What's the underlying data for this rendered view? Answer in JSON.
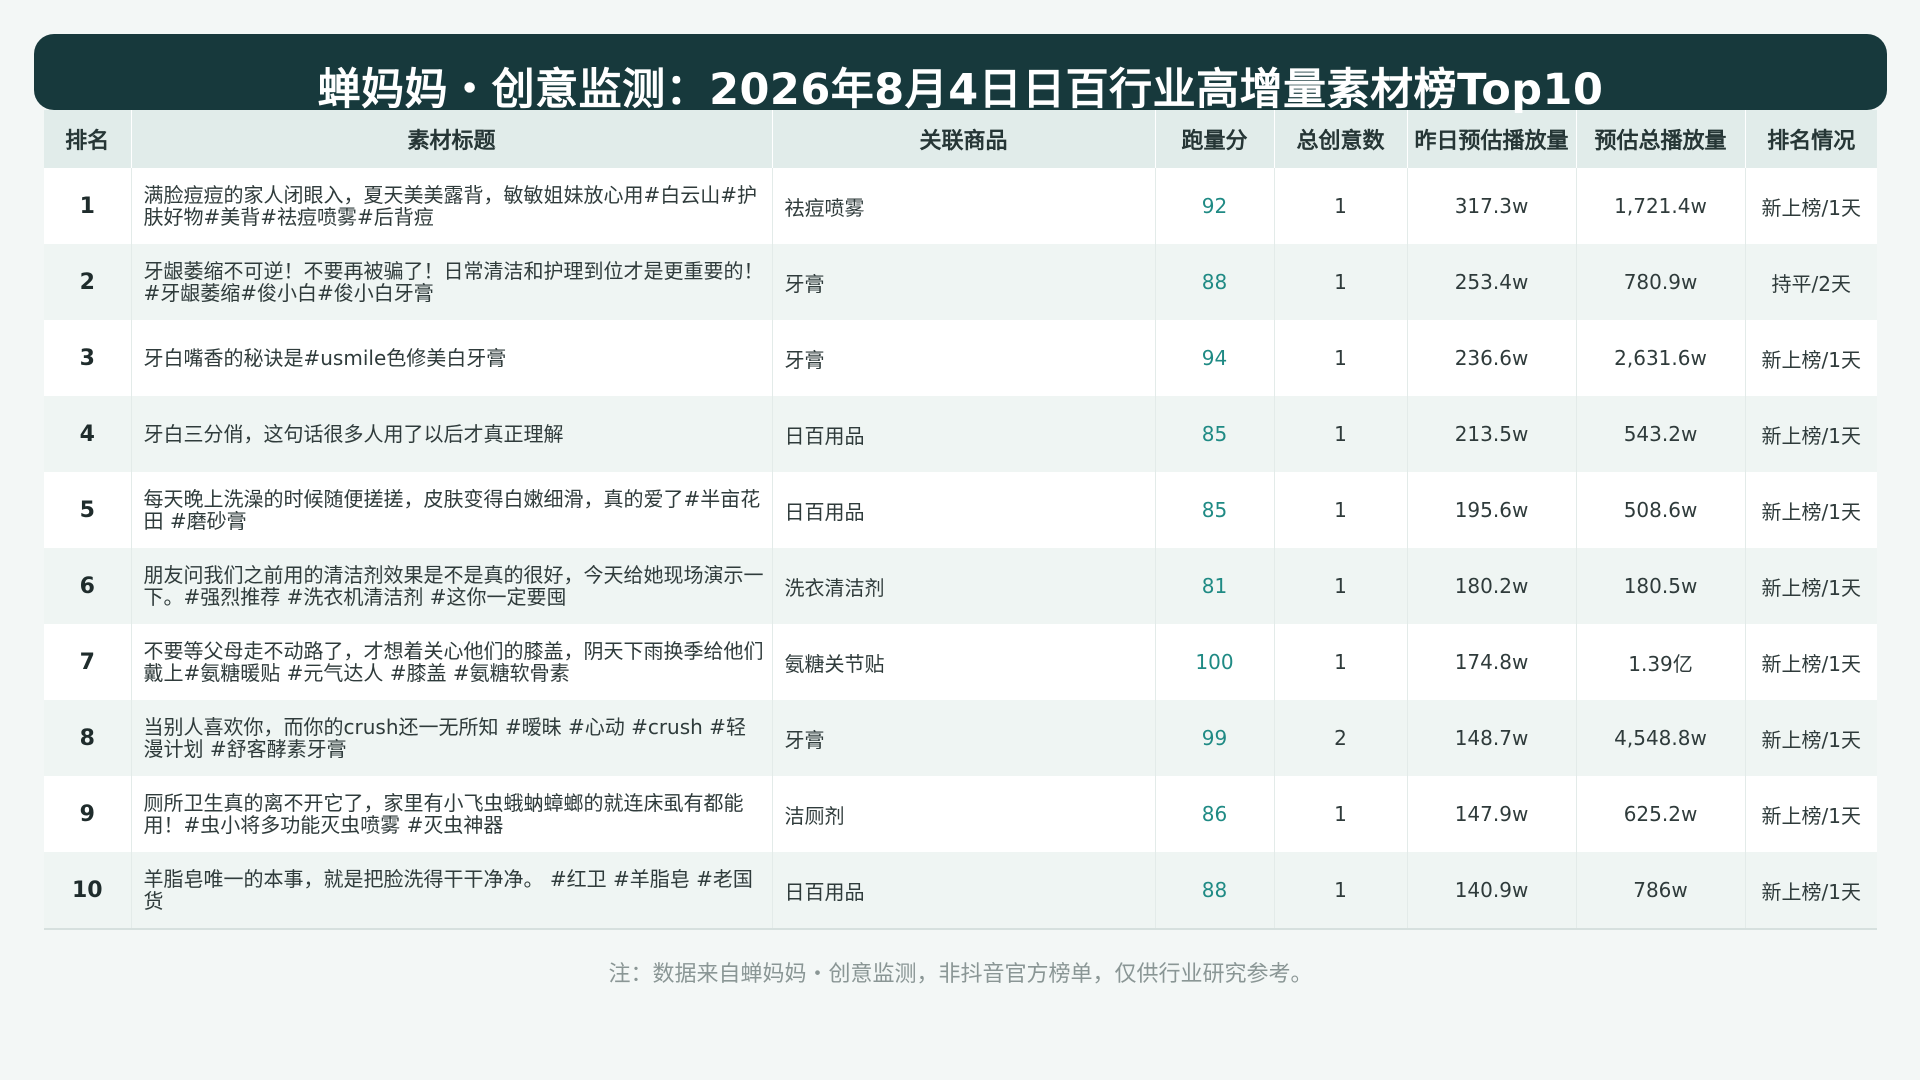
{
  "title": "蝉妈妈・创意监测：2026年8月4日日百行业高增量素材榜Top10",
  "columns": [
    "排名",
    "素材标题",
    "关联商品",
    "跑量分",
    "总创意数",
    "昨日预估播放量",
    "预估总播放量",
    "排名情况"
  ],
  "rows": [
    {
      "rank": "1",
      "title": "满脸痘痘的家人闭眼入，夏天美美露背，敏敏姐妹放心用#白云山#护肤好物#美背#祛痘喷雾#后背痘",
      "product": "祛痘喷雾",
      "score": "92",
      "creatives": "1",
      "yesterday": "317.3w",
      "total": "1,721.4w",
      "status": "新上榜/1天"
    },
    {
      "rank": "2",
      "title": "牙龈萎缩不可逆！不要再被骗了！日常清洁和护理到位才是更重要的！#牙龈萎缩#俊小白#俊小白牙膏",
      "product": "牙膏",
      "score": "88",
      "creatives": "1",
      "yesterday": "253.4w",
      "total": "780.9w",
      "status": "持平/2天"
    },
    {
      "rank": "3",
      "title": "牙白嘴香的秘诀是#usmile色修美白牙膏",
      "product": "牙膏",
      "score": "94",
      "creatives": "1",
      "yesterday": "236.6w",
      "total": "2,631.6w",
      "status": "新上榜/1天"
    },
    {
      "rank": "4",
      "title": "牙白三分俏，这句话很多人用了以后才真正理解",
      "product": "日百用品",
      "score": "85",
      "creatives": "1",
      "yesterday": "213.5w",
      "total": "543.2w",
      "status": "新上榜/1天"
    },
    {
      "rank": "5",
      "title": "每天晚上洗澡的时候随便搓搓，皮肤变得白嫩细滑，真的爱了#半亩花田 #磨砂膏",
      "product": "日百用品",
      "score": "85",
      "creatives": "1",
      "yesterday": "195.6w",
      "total": "508.6w",
      "status": "新上榜/1天"
    },
    {
      "rank": "6",
      "title": "朋友问我们之前用的清洁剂效果是不是真的很好，今天给她现场演示一下。#强烈推荐 #洗衣机清洁剂 #这你一定要囤",
      "product": "洗衣清洁剂",
      "score": "81",
      "creatives": "1",
      "yesterday": "180.2w",
      "total": "180.5w",
      "status": "新上榜/1天"
    },
    {
      "rank": "7",
      "title": "不要等父母走不动路了，才想着关心他们的膝盖，阴天下雨换季给他们戴上#氨糖暖贴 #元气达人 #膝盖 #氨糖软骨素",
      "product": "氨糖关节贴",
      "score": "100",
      "creatives": "1",
      "yesterday": "174.8w",
      "total": "1.39亿",
      "status": "新上榜/1天"
    },
    {
      "rank": "8",
      "title": "当别人喜欢你，而你的crush还一无所知 #暧昧 #心动 #crush #轻漫计划 #舒客酵素牙膏",
      "product": "牙膏",
      "score": "99",
      "creatives": "2",
      "yesterday": "148.7w",
      "total": "4,548.8w",
      "status": "新上榜/1天"
    },
    {
      "rank": "9",
      "title": "厕所卫生真的离不开它了，家里有小飞虫蛾蚋蟑螂的就连床虱有都能用！#虫小将多功能灭虫喷雾 #灭虫神器",
      "product": "洁厕剂",
      "score": "86",
      "creatives": "1",
      "yesterday": "147.9w",
      "total": "625.2w",
      "status": "新上榜/1天"
    },
    {
      "rank": "10",
      "title": "羊脂皂唯一的本事，就是把脸洗得干干净净。 #红卫 #羊脂皂 #老国货",
      "product": "日百用品",
      "score": "88",
      "creatives": "1",
      "yesterday": "140.9w",
      "total": "786w",
      "status": "新上榜/1天"
    }
  ],
  "footnote": "注：数据来自蝉妈妈・创意监测，非抖音官方榜单，仅供行业研究参考。",
  "colors": {
    "header_bg": "#17393c",
    "score_text": "#1f8a84",
    "thead_bg": "#e1ecea",
    "row_alt_bg": "#eff5f3"
  }
}
